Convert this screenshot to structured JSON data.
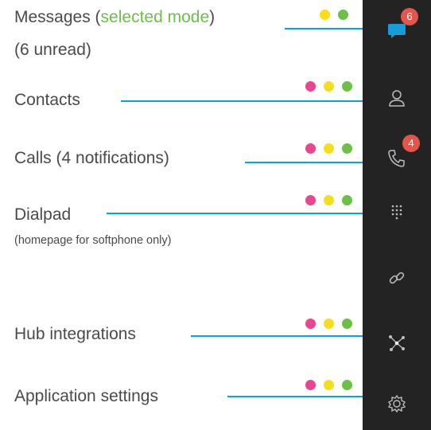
{
  "colors": {
    "sidebar_bg": "#232323",
    "connector": "#0aa5d6",
    "dot_pink": "#e8478f",
    "dot_yellow": "#f4de1f",
    "dot_green": "#6cc04a",
    "accent_green": "#6cc04a",
    "badge_red": "#e4564b",
    "icon_gray": "#bdbdbd",
    "icon_blue": "#1a9bd8"
  },
  "callouts": {
    "messages": {
      "label": "Messages (",
      "mode": "selected mode",
      "close": ")",
      "sub": "(6 unread)"
    },
    "contacts": {
      "label": "Contacts"
    },
    "calls": {
      "label": "Calls (4 notifications)"
    },
    "dialpad": {
      "label": "Dialpad",
      "sub": "(homepage for softphone only)"
    },
    "hub": {
      "label": "Hub integrations"
    },
    "settings": {
      "label": "Application settings"
    }
  },
  "sidebar": {
    "items": [
      {
        "icon": "messages-icon",
        "badge": "6",
        "selected": true
      },
      {
        "icon": "contacts-icon"
      },
      {
        "icon": "calls-icon",
        "badge": "4"
      },
      {
        "icon": "dialpad-icon"
      },
      {
        "icon": "link-icon"
      },
      {
        "icon": "hub-integrations-icon"
      },
      {
        "icon": "settings-gear-icon"
      }
    ]
  }
}
